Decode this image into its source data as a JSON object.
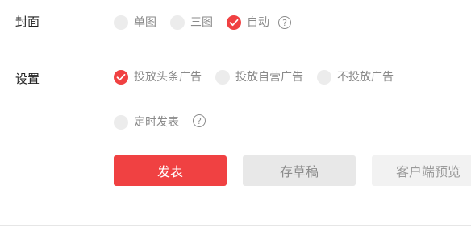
{
  "cover": {
    "label": "封面",
    "options": [
      {
        "label": "单图",
        "checked": false
      },
      {
        "label": "三图",
        "checked": false
      },
      {
        "label": "自动",
        "checked": true
      }
    ],
    "help_icon": "question-circle-icon"
  },
  "settings": {
    "label": "设置",
    "ad_options": [
      {
        "label": "投放头条广告",
        "checked": true
      },
      {
        "label": "投放自营广告",
        "checked": false
      },
      {
        "label": "不投放广告",
        "checked": false
      }
    ],
    "schedule": {
      "label": "定时发表",
      "checked": false
    },
    "help_icon": "question-circle-icon"
  },
  "actions": {
    "publish_label": "发表",
    "draft_label": "存草稿",
    "preview_label": "客户端预览"
  },
  "colors": {
    "accent": "#f04142",
    "unchecked": "#ececec",
    "muted_text": "#8a8a8a"
  }
}
